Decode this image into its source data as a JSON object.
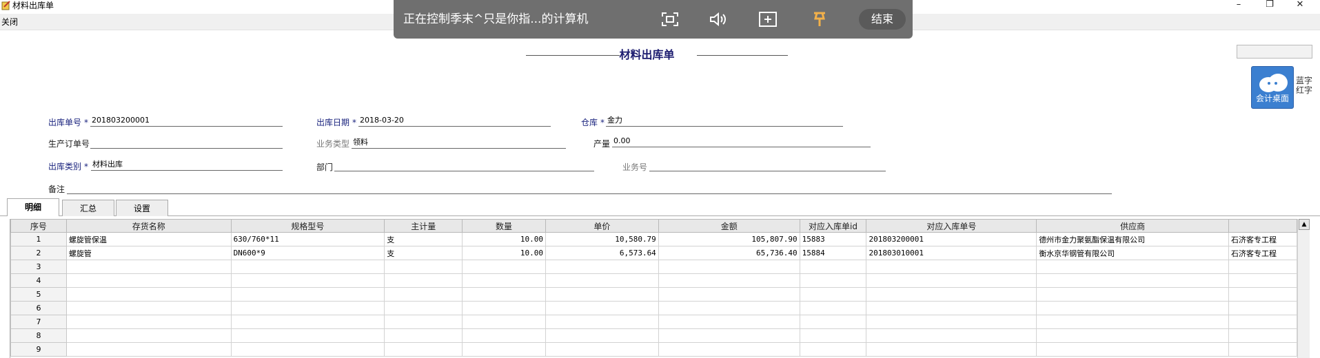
{
  "window": {
    "title": "材料出库单",
    "minimize": "–",
    "maximize": "❐",
    "close": "✕"
  },
  "menu": {
    "close_label": "关闭"
  },
  "remote_bar": {
    "text": "正在控制季末^只是你指...的计算机",
    "end_label": "结束",
    "icons": [
      "fullscreen-icon",
      "sound-icon",
      "plus-box-icon",
      "pin-icon"
    ]
  },
  "document": {
    "title": "材料出库单"
  },
  "desktop_widget": {
    "label": "会计桌面",
    "side1": "蓝字",
    "side2": "红字"
  },
  "form": {
    "outbound_no": {
      "label": "出库单号",
      "value": "201803200001"
    },
    "outbound_date": {
      "label": "出库日期",
      "value": "2018-03-20"
    },
    "warehouse": {
      "label": "仓库",
      "value": "金力"
    },
    "production_order": {
      "label": "生产订单号",
      "value": ""
    },
    "business_type": {
      "label": "业务类型",
      "value": "领料"
    },
    "output": {
      "label": "产量",
      "value": "0.00"
    },
    "outbound_category": {
      "label": "出库类别",
      "value": "材料出库"
    },
    "department": {
      "label": "部门",
      "value": ""
    },
    "business_no": {
      "label": "业务号",
      "value": ""
    },
    "remark": {
      "label": "备注",
      "value": ""
    }
  },
  "tabs": [
    "明细",
    "汇总",
    "设置"
  ],
  "grid": {
    "columns": [
      "序号",
      "存货名称",
      "规格型号",
      "主计量",
      "数量",
      "单价",
      "金额",
      "对应入库单id",
      "对应入库单号",
      "供应商",
      ""
    ],
    "rows": [
      [
        "1",
        "螺旋管保温",
        "630/760*11",
        "支",
        "10.00",
        "10,580.79",
        "105,807.90",
        "15883",
        "201803200001",
        "德州市金力聚氨酯保温有限公司",
        "石济客专工程"
      ],
      [
        "2",
        "螺旋管",
        "DN600*9",
        "支",
        "10.00",
        "6,573.64",
        "65,736.40",
        "15884",
        "201803010001",
        "衡水京华钢管有限公司",
        "石济客专工程"
      ],
      [
        "3",
        "",
        "",
        "",
        "",
        "",
        "",
        "",
        "",
        "",
        ""
      ],
      [
        "4",
        "",
        "",
        "",
        "",
        "",
        "",
        "",
        "",
        "",
        ""
      ],
      [
        "5",
        "",
        "",
        "",
        "",
        "",
        "",
        "",
        "",
        "",
        ""
      ],
      [
        "6",
        "",
        "",
        "",
        "",
        "",
        "",
        "",
        "",
        "",
        ""
      ],
      [
        "7",
        "",
        "",
        "",
        "",
        "",
        "",
        "",
        "",
        "",
        ""
      ],
      [
        "8",
        "",
        "",
        "",
        "",
        "",
        "",
        "",
        "",
        "",
        ""
      ],
      [
        "9",
        "",
        "",
        "",
        "",
        "",
        "",
        "",
        "",
        "",
        ""
      ]
    ]
  }
}
